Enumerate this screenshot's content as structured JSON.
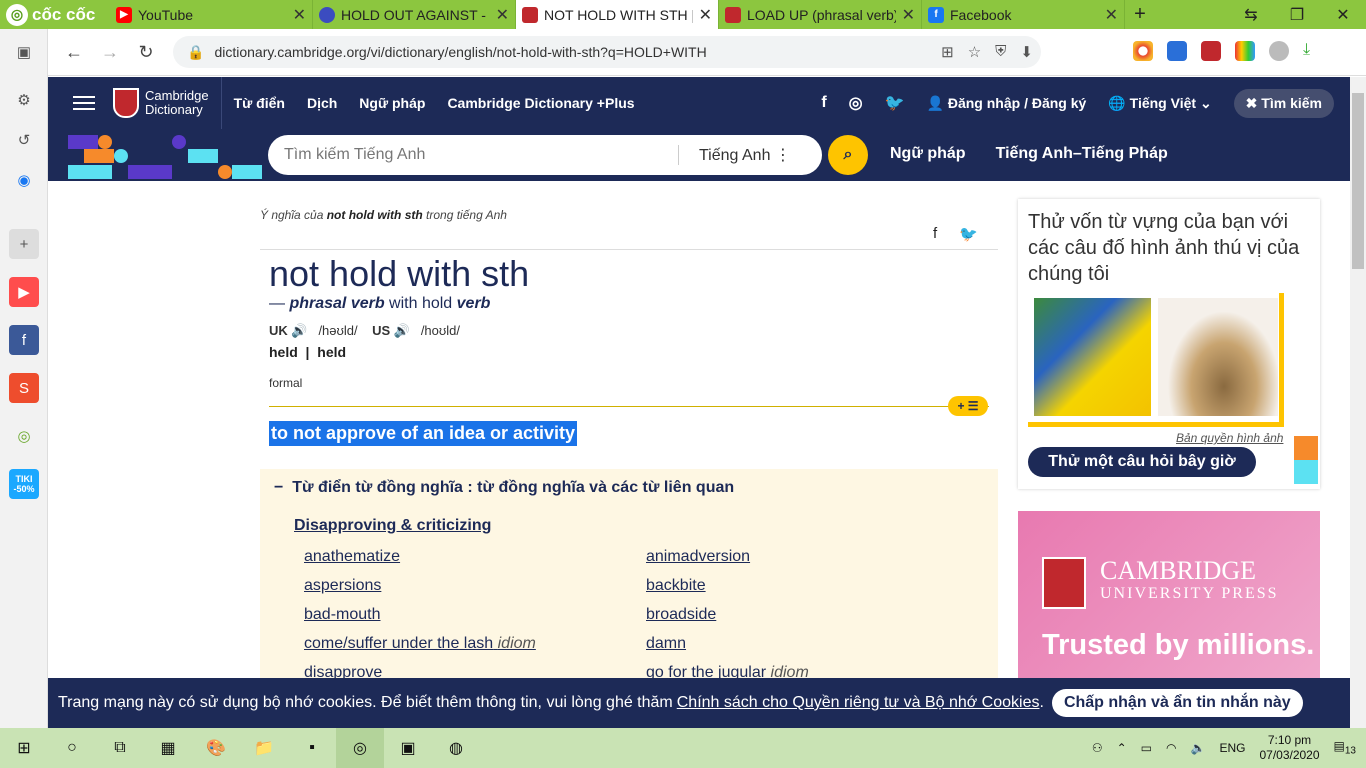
{
  "browser": {
    "brand": "cốc cốc",
    "tabs": [
      {
        "title": "YouTube",
        "color": "#ff0000"
      },
      {
        "title": "HOLD OUT AGAINST - [",
        "color": "#3b4cc0"
      },
      {
        "title": "NOT HOLD WITH STH |",
        "color": "#c0282d"
      },
      {
        "title": "LOAD UP (phrasal verb)",
        "color": "#c0282d"
      },
      {
        "title": "Facebook",
        "color": "#1877f2"
      }
    ],
    "url": "dictionary.cambridge.org/vi/dictionary/english/not-hold-with-sth?q=HOLD+WITH"
  },
  "sidebar": {
    "tiki_label": "TIKI -50%"
  },
  "header": {
    "logo_line1": "Cambridge",
    "logo_line2": "Dictionary",
    "nav": [
      "Từ điển",
      "Dịch",
      "Ngữ pháp",
      "Cambridge Dictionary +Plus"
    ],
    "login": "Đăng nhập / Đăng ký",
    "language": "Tiếng Việt",
    "search_button": "Tìm kiếm"
  },
  "search": {
    "placeholder": "Tìm kiếm Tiếng Anh",
    "lang": "Tiếng Anh",
    "links": [
      "Ngữ pháp",
      "Tiếng Anh–Tiếng Pháp"
    ]
  },
  "entry": {
    "crumb_pre": "Ý nghĩa của ",
    "crumb_word": "not hold with sth",
    "crumb_post": " trong tiếng Anh",
    "headword": "not hold with sth",
    "pos_dash": "— ",
    "pos": "phrasal verb",
    "with_text": " with hold ",
    "pos2": "verb",
    "uk_label": "UK",
    "uk_ipa": "/həʊld/",
    "us_label": "US",
    "us_ipa": "/hoʊld/",
    "forms": [
      "held",
      "held"
    ],
    "register": "formal",
    "definition": "to not approve of an idea or activity"
  },
  "thesaurus": {
    "heading": "Từ điển từ đồng nghĩa : từ đồng nghĩa và các từ liên quan",
    "subheading": "Disapproving & criticizing",
    "left": [
      {
        "w": "anathematize",
        "tag": ""
      },
      {
        "w": "aspersions",
        "tag": ""
      },
      {
        "w": "bad-mouth",
        "tag": ""
      },
      {
        "w": "come/suffer under the lash",
        "tag": "idiom"
      },
      {
        "w": "disapprove",
        "tag": ""
      }
    ],
    "right": [
      {
        "w": "animadversion",
        "tag": ""
      },
      {
        "w": "backbite",
        "tag": ""
      },
      {
        "w": "broadside",
        "tag": ""
      },
      {
        "w": "damn",
        "tag": ""
      },
      {
        "w": "go for the jugular",
        "tag": "idiom"
      }
    ]
  },
  "quiz": {
    "title": "Thử vốn từ vựng của bạn với các câu đố hình ảnh thú vị của chúng tôi",
    "copyright": "Bản quyền hình ảnh",
    "button": "Thử một câu hỏi bây giờ"
  },
  "ad": {
    "line1": "CAMBRIDGE",
    "line2": "UNIVERSITY PRESS",
    "slogan": "Trusted by millions."
  },
  "cookie": {
    "text": "Trang mạng này có sử dụng bộ nhớ cookies. Để biết thêm thông tin, vui lòng ghé thăm",
    "link": "Chính sách cho Quyền riêng tư và Bộ nhớ Cookies",
    "after": ".",
    "button": "Chấp nhận và ẩn tin nhắn này"
  },
  "taskbar": {
    "lang": "ENG",
    "time": "7:10 pm",
    "date": "07/03/2020",
    "notifications": "13"
  }
}
